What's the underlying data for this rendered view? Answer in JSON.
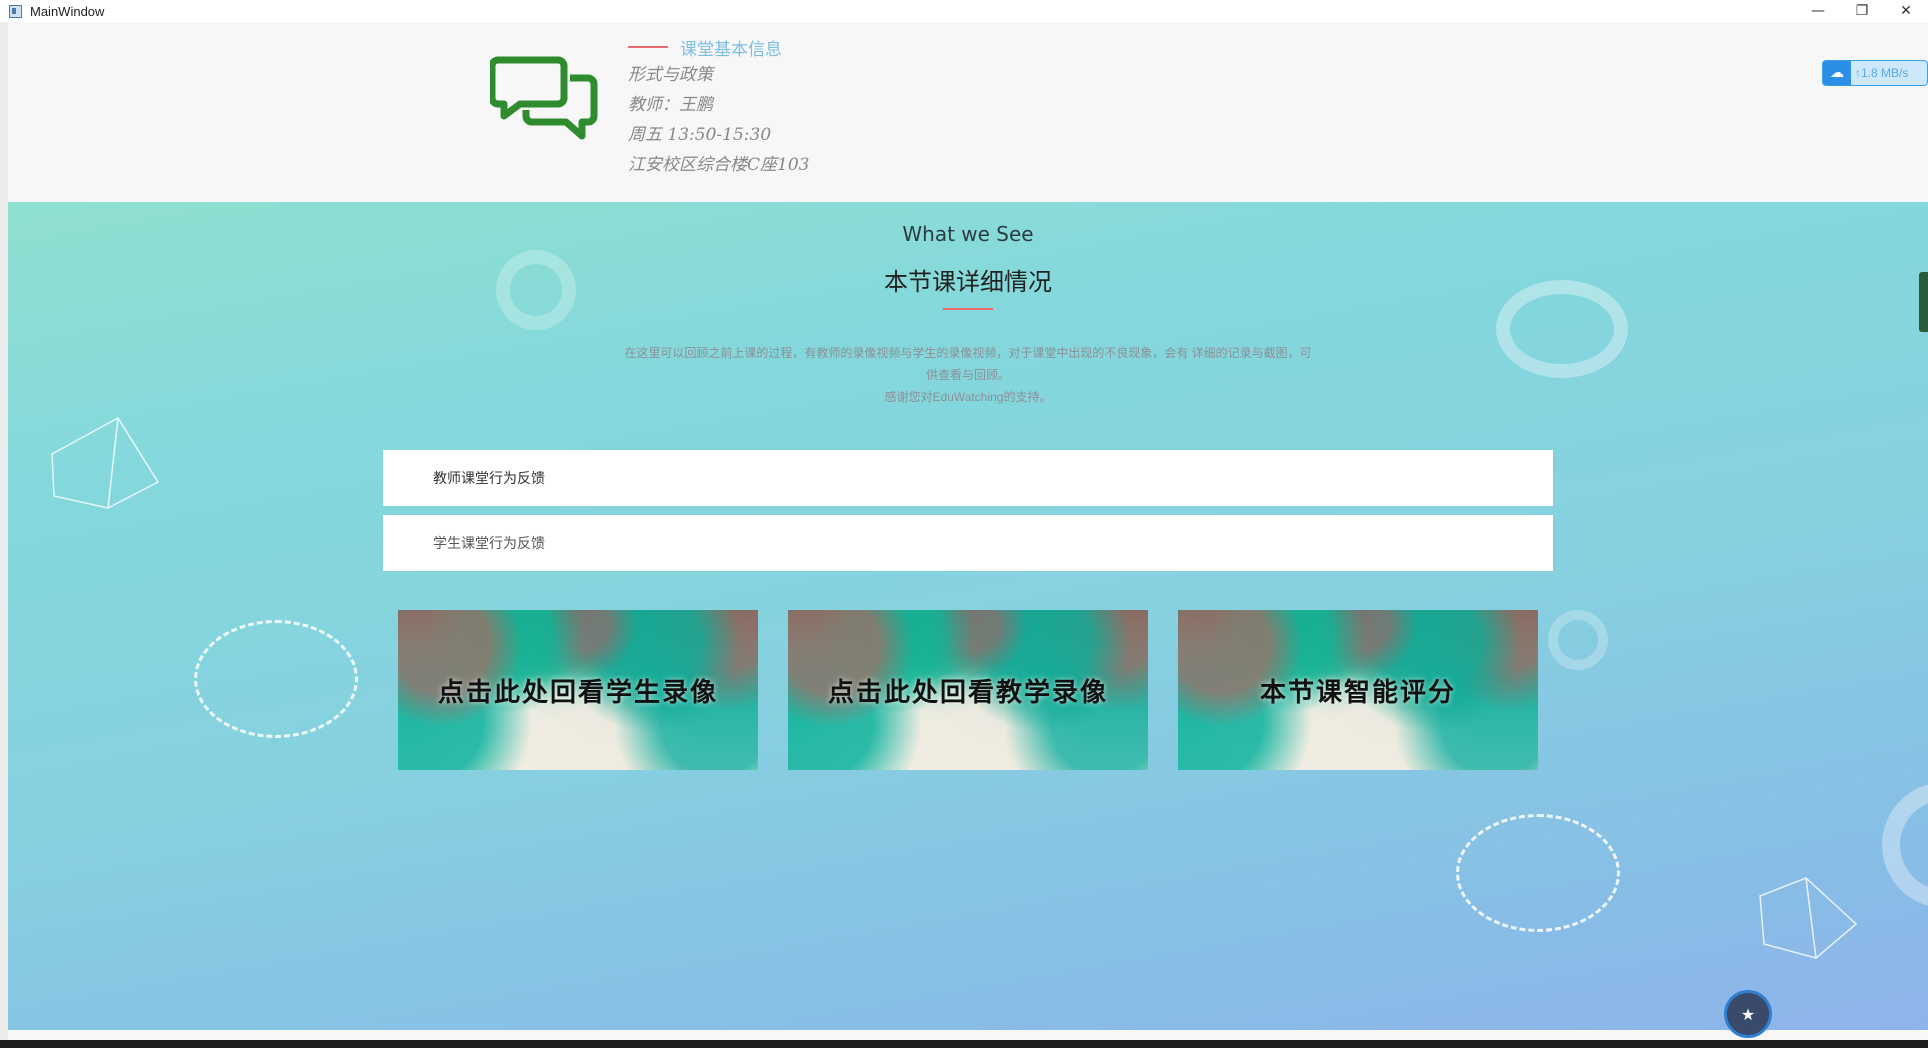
{
  "window": {
    "title": "MainWindow",
    "minimize": "—",
    "maximize": "❐",
    "close": "✕"
  },
  "header": {
    "section_title": "课堂基本信息",
    "course": "形式与政策",
    "teacher": "教师：王鹏",
    "time": "周五 13:50-15:30",
    "location": "江安校区综合楼C座103",
    "speed_badge": "↑1.8 MB/s"
  },
  "main": {
    "eyebrow": "What we See",
    "title": "本节课详细情况",
    "description_1": "在这里可以回顾之前上课的过程，有教师的录像视频与学生的录像视频，对于课堂中出现的不良现象，会有 详细的记录与截图，可",
    "description_2": "供查看与回顾。",
    "description_3": "感谢您对EduWatching的支持。",
    "accordion": [
      {
        "label": "教师课堂行为反馈"
      },
      {
        "label": "学生课堂行为反馈"
      }
    ],
    "cards": [
      {
        "label": "点击此处回看学生录像"
      },
      {
        "label": "点击此处回看教学录像"
      },
      {
        "label": "本节课智能评分"
      }
    ]
  },
  "colors": {
    "accent_red": "#e86a6a",
    "title_blue": "#7cbde3",
    "chat_icon_green": "#2e8b2e"
  },
  "icons": {
    "app": "app-window-icon",
    "chat": "chat-bubbles-icon",
    "cloud": "cloud-upload-icon",
    "avatar": "user-avatar-icon"
  }
}
